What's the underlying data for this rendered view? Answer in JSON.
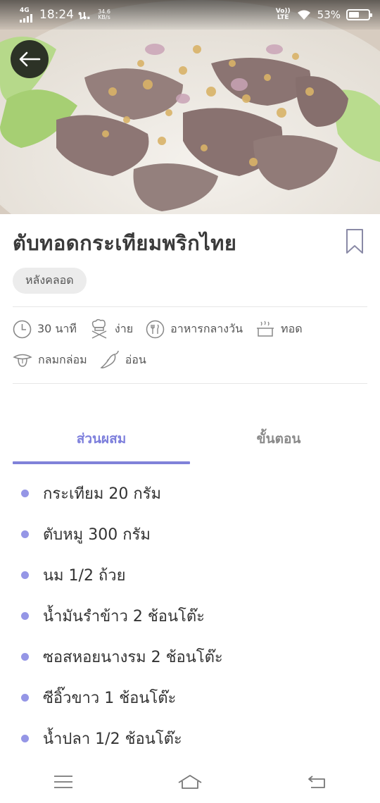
{
  "status_bar": {
    "network": "4G",
    "time": "18:24",
    "carrier_mark": "น.",
    "speed_value": "34.6",
    "speed_unit": "KB/s",
    "volte_top": "Vo))",
    "volte_bottom": "LTE",
    "battery": "53%",
    "battery_level": 0.53
  },
  "recipe": {
    "title": "ตับทอดกระเทียมพริกไทย",
    "category_chip": "หลังคลอด",
    "meta": {
      "time": "30 นาที",
      "difficulty": "ง่าย",
      "meal": "อาหารกลางวัน",
      "method": "ทอด",
      "taste": "กลมกล่อม",
      "spiciness": "อ่อน"
    }
  },
  "tabs": {
    "ingredients": "ส่วนผสม",
    "steps": "ขั้นตอน",
    "active": "ingredients"
  },
  "ingredients": [
    "กระเทียม 20 กรัม",
    "ตับหมู 300 กรัม",
    "นม 1/2 ถ้วย",
    "น้ำมันรำข้าว 2 ช้อนโต๊ะ",
    "ซอสหอยนางรม 2 ช้อนโต๊ะ",
    "ซีอิ๊วขาว 1 ช้อนโต๊ะ",
    "น้ำปลา 1/2 ช้อนโต๊ะ"
  ],
  "icons": {
    "back": "arrow-left-icon",
    "bookmark": "bookmark-icon",
    "time": "clock-icon",
    "difficulty": "chef-icon",
    "meal": "fork-knife-plate-icon",
    "method": "frying-pot-icon",
    "taste": "tongue-icon",
    "spiciness": "chili-icon"
  },
  "colors": {
    "accent": "#7d7fdc",
    "bullet": "#9596e6",
    "chip_bg": "#ececec",
    "title": "#3a3a3a"
  }
}
